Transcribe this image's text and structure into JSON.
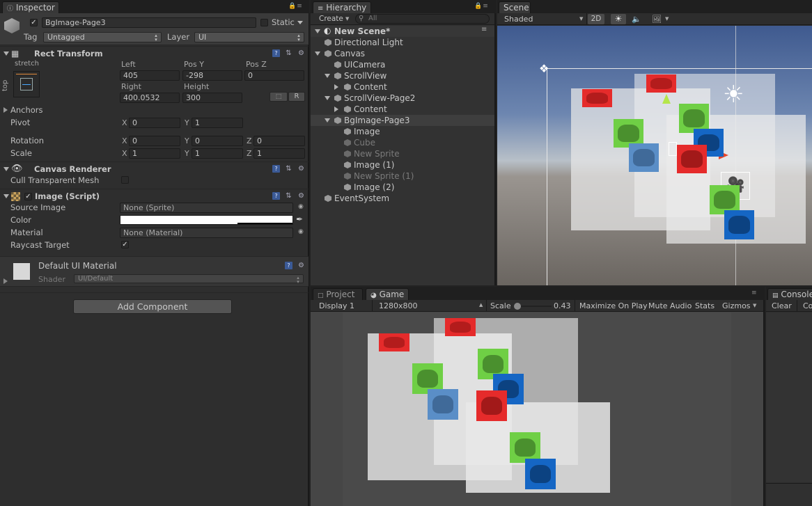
{
  "inspector": {
    "tab_label": "Inspector",
    "object": {
      "name": "BgImage-Page3",
      "active": true,
      "static_label": "Static",
      "tag_label": "Tag",
      "tag_value": "Untagged",
      "layer_label": "Layer",
      "layer_value": "UI"
    },
    "rect_transform": {
      "title": "Rect Transform",
      "anchor_preset_h": "stretch",
      "anchor_preset_v": "top",
      "labels": {
        "left": "Left",
        "posy": "Pos Y",
        "posz": "Pos Z",
        "right": "Right",
        "height": "Height"
      },
      "values": {
        "left": "405",
        "posy": "-298",
        "posz": "0",
        "right": "400.0532",
        "height": "300"
      },
      "raw_button": "R",
      "anchors_label": "Anchors",
      "pivot_label": "Pivot",
      "pivot": {
        "x": "0",
        "y": "1"
      },
      "rotation_label": "Rotation",
      "rotation": {
        "x": "0",
        "y": "0",
        "z": "0"
      },
      "scale_label": "Scale",
      "scale": {
        "x": "1",
        "y": "1",
        "z": "1"
      },
      "axis": {
        "x": "X",
        "y": "Y",
        "z": "Z"
      }
    },
    "canvas_renderer": {
      "title": "Canvas Renderer",
      "cull_label": "Cull Transparent Mesh",
      "cull_checked": false
    },
    "image_script": {
      "title": "Image (Script)",
      "enabled": true,
      "source_image_label": "Source Image",
      "source_image_value": "None (Sprite)",
      "color_label": "Color",
      "color_value": "#ffffff",
      "material_label": "Material",
      "material_value": "None (Material)",
      "raycast_label": "Raycast Target",
      "raycast_checked": true
    },
    "material": {
      "name": "Default UI Material",
      "shader_label": "Shader",
      "shader_value": "UI/Default"
    },
    "add_component_label": "Add Component"
  },
  "hierarchy": {
    "tab_label": "Hierarchy",
    "create_label": "Create",
    "search_placeholder": "All",
    "scene_name": "New Scene*",
    "items": [
      {
        "label": "Directional Light",
        "depth": 1,
        "arrow": "",
        "dim": false,
        "selected": false
      },
      {
        "label": "Canvas",
        "depth": 1,
        "arrow": "down",
        "dim": false,
        "selected": false
      },
      {
        "label": "UICamera",
        "depth": 2,
        "arrow": "",
        "dim": false,
        "selected": false
      },
      {
        "label": "ScrollView",
        "depth": 2,
        "arrow": "down",
        "dim": false,
        "selected": false
      },
      {
        "label": "Content",
        "depth": 3,
        "arrow": "right",
        "dim": false,
        "selected": false
      },
      {
        "label": "ScrollView-Page2",
        "depth": 2,
        "arrow": "down",
        "dim": false,
        "selected": false
      },
      {
        "label": "Content",
        "depth": 3,
        "arrow": "right",
        "dim": false,
        "selected": false
      },
      {
        "label": "BgImage-Page3",
        "depth": 2,
        "arrow": "down",
        "dim": false,
        "selected": true
      },
      {
        "label": "Image",
        "depth": 3,
        "arrow": "",
        "dim": false,
        "selected": false
      },
      {
        "label": "Cube",
        "depth": 3,
        "arrow": "",
        "dim": true,
        "selected": false
      },
      {
        "label": "New Sprite",
        "depth": 3,
        "arrow": "",
        "dim": true,
        "selected": false
      },
      {
        "label": "Image (1)",
        "depth": 3,
        "arrow": "",
        "dim": false,
        "selected": false
      },
      {
        "label": "New Sprite (1)",
        "depth": 3,
        "arrow": "",
        "dim": true,
        "selected": false
      },
      {
        "label": "Image (2)",
        "depth": 3,
        "arrow": "",
        "dim": false,
        "selected": false
      },
      {
        "label": "EventSystem",
        "depth": 1,
        "arrow": "",
        "dim": false,
        "selected": false
      }
    ]
  },
  "scene": {
    "tab_label": "Scene",
    "shading_mode": "Shaded",
    "mode_2d": "2D"
  },
  "bottom_tabs": {
    "project": "Project",
    "game": "Game",
    "console": "Console"
  },
  "game": {
    "display": "Display 1",
    "resolution": "1280x800",
    "scale_label": "Scale",
    "scale_value": "0.43",
    "maximize": "Maximize On Play",
    "mute": "Mute Audio",
    "stats": "Stats",
    "gizmos": "Gizmos"
  },
  "console": {
    "clear": "Clear",
    "collapse": "Co"
  },
  "colors": {
    "red_sprite": "#e52b2b",
    "green_sprite": "#6fcf45",
    "blue_sprite": "#1566c4",
    "faded_blue_sprite": "#5a8ec7",
    "selection": "#3e3e3e",
    "scene_sky": "#4e6a9e"
  }
}
